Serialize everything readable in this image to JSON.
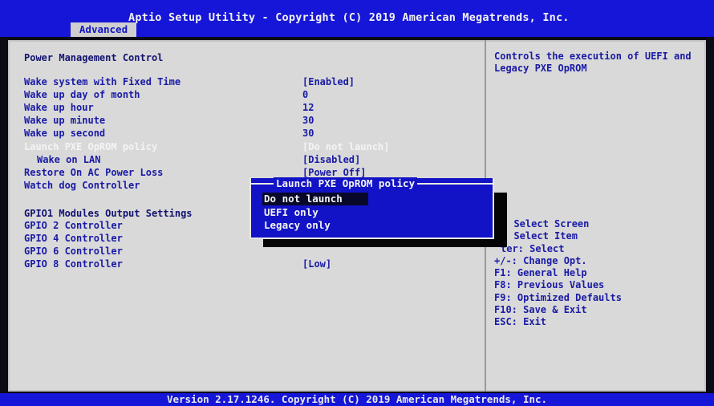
{
  "header": {
    "title": "Aptio Setup Utility - Copyright (C) 2019 American Megatrends, Inc.",
    "active_tab": "Advanced"
  },
  "settings": {
    "section_title": "Power Management Control",
    "rows": [
      {
        "label": "Wake system with Fixed Time",
        "value": "[Enabled]"
      },
      {
        "label": "Wake up day of month",
        "value": "0"
      },
      {
        "label": "Wake up hour",
        "value": "12"
      },
      {
        "label": "Wake up minute",
        "value": "30"
      },
      {
        "label": "Wake up second",
        "value": "30"
      },
      {
        "label": "Launch PXE OpROM policy",
        "value": "[Do not launch]"
      },
      {
        "label": "Wake on LAN",
        "value": "[Disabled]"
      },
      {
        "label": "Restore On AC Power Loss",
        "value": "[Power Off]"
      },
      {
        "label": "Watch dog Controller",
        "value": ""
      }
    ],
    "gpio_section_title": "GPIO1 Modules Output Settings",
    "gpio_rows": [
      {
        "label": "GPIO 2 Controller",
        "value": ""
      },
      {
        "label": "GPIO 4 Controller",
        "value": ""
      },
      {
        "label": "GPIO 6 Controller",
        "value": ""
      },
      {
        "label": "GPIO 8 Controller",
        "value": "[Low]"
      }
    ]
  },
  "popup": {
    "title": "Launch PXE OpROM policy",
    "options": [
      "Do not launch",
      "UEFI only",
      "Legacy only"
    ],
    "selected": "Do not launch"
  },
  "help": {
    "description": "Controls the execution of UEFI and Legacy PXE OpROM",
    "keys": [
      ": Select Screen",
      ": Select Item",
      "ter: Select",
      "+/-: Change Opt.",
      "F1: General Help",
      "F8: Previous Values",
      "F9: Optimized Defaults",
      "F10: Save & Exit",
      "ESC: Exit"
    ]
  },
  "footer": {
    "text": "Version 2.17.1246. Copyright (C) 2019 American Megatrends, Inc."
  },
  "colors": {
    "header_blue": "#1616d8",
    "panel_gray": "#d9d9d9",
    "item_blue": "#1a1aa6",
    "highlight_white": "#f4f4f4",
    "popup_blue": "#1212c6"
  }
}
